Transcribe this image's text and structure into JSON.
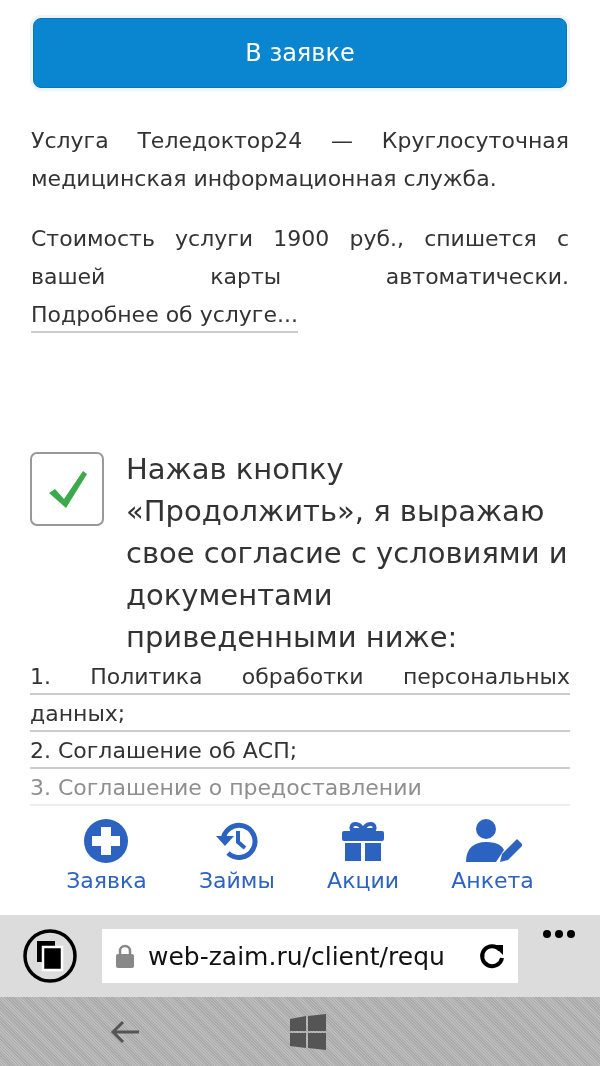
{
  "apply_button": {
    "label": "В заявке"
  },
  "description": "Услуга Теледоктор24 — Круглосуточная медицинская информационная служба.",
  "cost": {
    "text": "Стоимость услуги 1900 руб., спишется с вашей карты автоматически.",
    "link": "Подробнее об услуге..."
  },
  "consent": {
    "checked": true,
    "text": "Нажав кнопку «Продолжить», я выражаю свое согласие с условиями и документами приведенными ниже:"
  },
  "documents": [
    {
      "text": "1. Политика обработки персональных данных;",
      "faded": false
    },
    {
      "text": "2. Соглашение об АСП;",
      "faded": false
    },
    {
      "text": "3. Соглашение о предоставлении",
      "faded": true
    }
  ],
  "bottom_nav": [
    {
      "label": "Заявка",
      "kind": "add"
    },
    {
      "label": "Займы",
      "kind": "history"
    },
    {
      "label": "Акции",
      "kind": "gift"
    },
    {
      "label": "Анкета",
      "kind": "profile"
    }
  ],
  "browser": {
    "address": "web-zaim.ru/client/requ"
  }
}
